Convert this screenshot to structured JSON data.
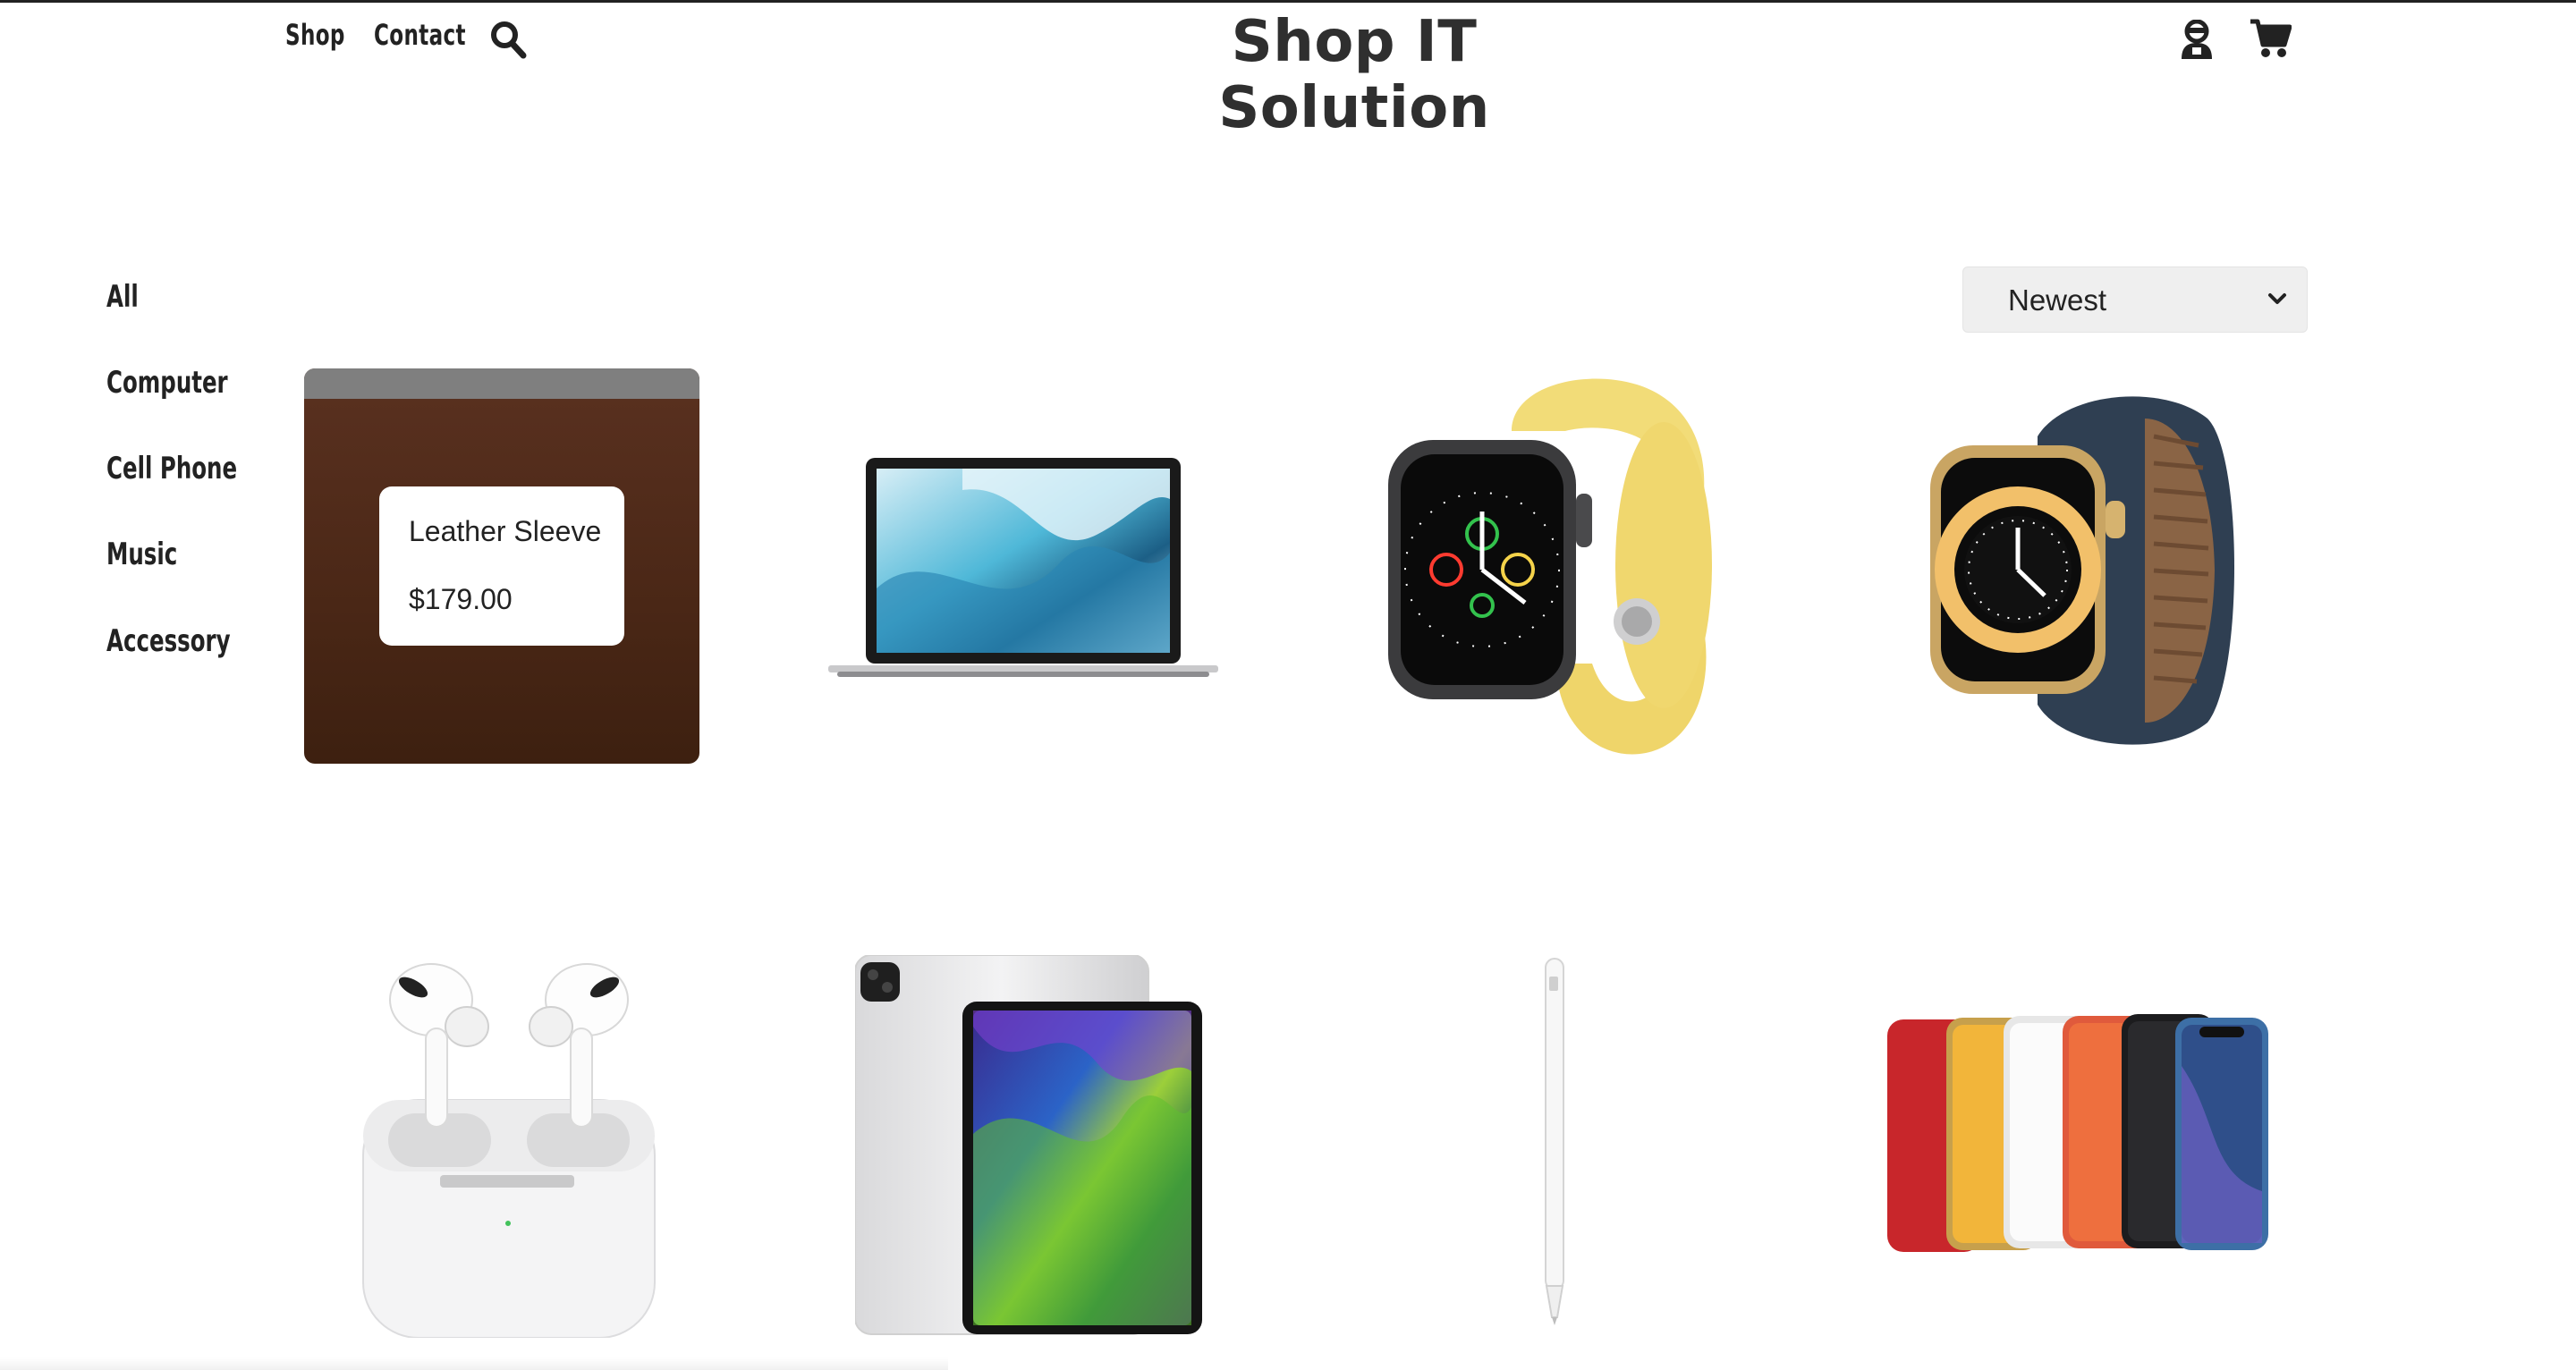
{
  "header": {
    "nav": [
      "Shop",
      "Contact"
    ],
    "brand": "Shop IT Solution",
    "icons": [
      "search-icon",
      "user-icon",
      "cart-icon"
    ]
  },
  "sidebar": {
    "categories": [
      "All",
      "Computer",
      "Cell Phone",
      "Music",
      "Accessory"
    ]
  },
  "sort": {
    "selected": "Newest",
    "icon": "chevron-down-icon"
  },
  "products": [
    {
      "name": "Leather Sleeve",
      "price": "$179.00",
      "image": "leather-sleeve",
      "hovered": true
    },
    {
      "image": "macbook-air"
    },
    {
      "image": "apple-watch-yellow"
    },
    {
      "image": "apple-watch-blue"
    },
    {
      "image": "airpods-pro"
    },
    {
      "image": "ipad-pro"
    },
    {
      "image": "apple-pencil"
    },
    {
      "image": "iphone-xr-lineup"
    }
  ],
  "colors": {
    "text": "#222222",
    "select_bg": "#efefef",
    "leather": "#4a2716"
  }
}
